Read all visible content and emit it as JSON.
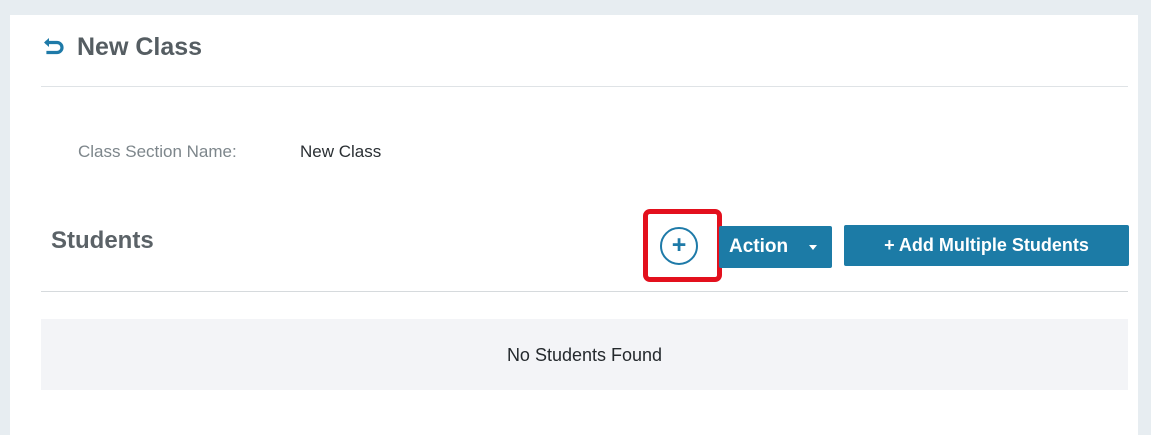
{
  "header": {
    "back_icon": "return-arrow-icon",
    "title": "New Class"
  },
  "form": {
    "class_section_label": "Class Section Name:",
    "class_section_value": "New Class"
  },
  "students": {
    "section_title": "Students",
    "add_icon": "plus-circle-icon",
    "add_symbol": "+",
    "action_label": "Action",
    "add_multiple_label": "+ Add Multiple Students",
    "empty_message": "No Students Found"
  },
  "colors": {
    "accent": "#1c7ba6",
    "highlight": "#e3101d",
    "background": "#e7edf1"
  }
}
